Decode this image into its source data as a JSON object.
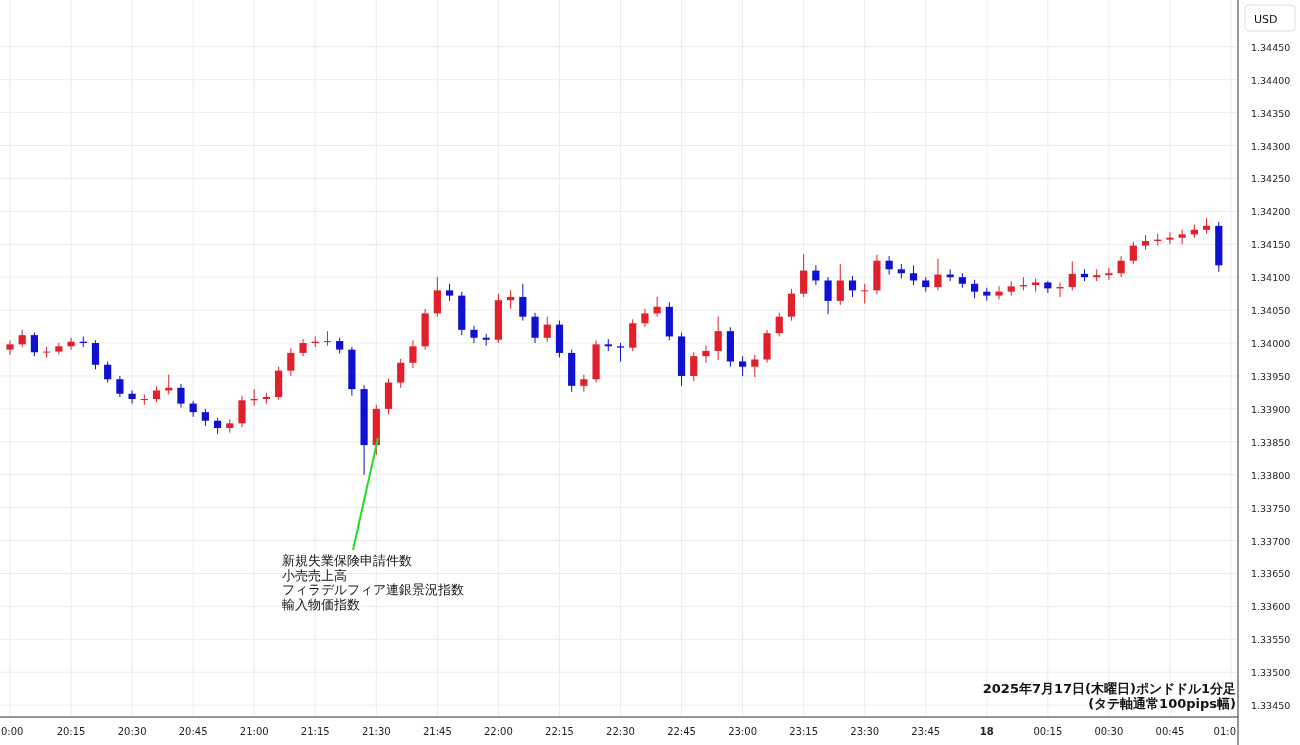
{
  "price_axis": {
    "currency": "USD"
  },
  "chart_data": {
    "type": "candlestick",
    "grid": true,
    "ylim": [
      1.33432,
      1.34521
    ],
    "categories": [
      "0:00",
      null,
      null,
      null,
      null,
      "20:15",
      null,
      null,
      null,
      null,
      "20:30",
      null,
      null,
      null,
      null,
      "20:45",
      null,
      null,
      null,
      null,
      "21:00",
      null,
      null,
      null,
      null,
      "21:15",
      null,
      null,
      null,
      null,
      "21:30",
      null,
      null,
      null,
      null,
      "21:45",
      null,
      null,
      null,
      null,
      "22:00",
      null,
      null,
      null,
      null,
      "22:15",
      null,
      null,
      null,
      null,
      "22:30",
      null,
      null,
      null,
      null,
      "22:45",
      null,
      null,
      null,
      null,
      "23:00",
      null,
      null,
      null,
      null,
      "23:15",
      null,
      null,
      null,
      null,
      "23:30",
      null,
      null,
      null,
      null,
      "23:45",
      null,
      null,
      null,
      null,
      "18",
      null,
      null,
      null,
      null,
      "00:15",
      null,
      null,
      null,
      null,
      "00:30",
      null,
      null,
      null,
      null,
      "00:45",
      null,
      null,
      null,
      null,
      "01:0"
    ],
    "ohlc": [
      [
        1.3399,
        1.34004,
        1.33982,
        1.33998
      ],
      [
        1.33998,
        1.3402,
        1.33994,
        1.34012
      ],
      [
        1.34012,
        1.34016,
        1.3398,
        1.33986
      ],
      [
        1.33986,
        1.33994,
        1.33978,
        1.33987
      ],
      [
        1.33987,
        1.34,
        1.33983,
        1.33995
      ],
      [
        1.33995,
        1.34008,
        1.3399,
        1.34002
      ],
      [
        1.34002,
        1.3401,
        1.33994,
        1.34
      ],
      [
        1.34,
        1.34004,
        1.3396,
        1.33967
      ],
      [
        1.33967,
        1.33972,
        1.3394,
        1.33945
      ],
      [
        1.33945,
        1.3395,
        1.33918,
        1.33923
      ],
      [
        1.33923,
        1.33928,
        1.33908,
        1.33915
      ],
      [
        1.33915,
        1.33922,
        1.33906,
        1.33915
      ],
      [
        1.33915,
        1.33934,
        1.3391,
        1.33928
      ],
      [
        1.33928,
        1.33952,
        1.33922,
        1.33932
      ],
      [
        1.33932,
        1.33938,
        1.33902,
        1.33908
      ],
      [
        1.33908,
        1.33912,
        1.33888,
        1.33895
      ],
      [
        1.33895,
        1.339,
        1.33874,
        1.33882
      ],
      [
        1.33882,
        1.33886,
        1.33862,
        1.33871
      ],
      [
        1.33871,
        1.33884,
        1.33864,
        1.33878
      ],
      [
        1.33878,
        1.3392,
        1.33872,
        1.33913
      ],
      [
        1.33913,
        1.3393,
        1.33905,
        1.33915
      ],
      [
        1.33915,
        1.33924,
        1.33908,
        1.33918
      ],
      [
        1.33918,
        1.33964,
        1.33914,
        1.33958
      ],
      [
        1.33958,
        1.33992,
        1.3395,
        1.33985
      ],
      [
        1.33985,
        1.34006,
        1.3398,
        1.34
      ],
      [
        1.34,
        1.3401,
        1.33994,
        1.34002
      ],
      [
        1.34002,
        1.34018,
        1.33996,
        1.34003
      ],
      [
        1.34003,
        1.34008,
        1.33984,
        1.3399
      ],
      [
        1.3399,
        1.33994,
        1.3392,
        1.3393
      ],
      [
        1.3393,
        1.33936,
        1.338,
        1.33845
      ],
      [
        1.33845,
        1.33906,
        1.3383,
        1.339
      ],
      [
        1.339,
        1.33946,
        1.33892,
        1.3394
      ],
      [
        1.3394,
        1.33976,
        1.33932,
        1.3397
      ],
      [
        1.3397,
        1.34004,
        1.33962,
        1.33995
      ],
      [
        1.33995,
        1.34052,
        1.3399,
        1.34045
      ],
      [
        1.34045,
        1.341,
        1.3404,
        1.3408
      ],
      [
        1.3408,
        1.3409,
        1.34064,
        1.34072
      ],
      [
        1.34072,
        1.34078,
        1.34012,
        1.3402
      ],
      [
        1.3402,
        1.34026,
        1.34,
        1.34008
      ],
      [
        1.34008,
        1.34014,
        1.33996,
        1.34005
      ],
      [
        1.34005,
        1.34075,
        1.34,
        1.34065
      ],
      [
        1.34065,
        1.3408,
        1.34052,
        1.3407
      ],
      [
        1.3407,
        1.3409,
        1.34034,
        1.3404
      ],
      [
        1.3404,
        1.34046,
        1.34,
        1.34008
      ],
      [
        1.34008,
        1.3404,
        1.34002,
        1.34028
      ],
      [
        1.34028,
        1.34034,
        1.33978,
        1.33985
      ],
      [
        1.33985,
        1.3399,
        1.33926,
        1.33935
      ],
      [
        1.33935,
        1.33952,
        1.33926,
        1.33945
      ],
      [
        1.33945,
        1.34004,
        1.3394,
        1.33998
      ],
      [
        1.33998,
        1.34006,
        1.33988,
        1.33995
      ],
      [
        1.33995,
        1.34,
        1.33972,
        1.33993
      ],
      [
        1.33993,
        1.34036,
        1.33988,
        1.3403
      ],
      [
        1.3403,
        1.34052,
        1.34024,
        1.34045
      ],
      [
        1.34045,
        1.3407,
        1.3404,
        1.34055
      ],
      [
        1.34055,
        1.34062,
        1.34004,
        1.3401
      ],
      [
        1.3401,
        1.34016,
        1.33935,
        1.3395
      ],
      [
        1.3395,
        1.33986,
        1.33942,
        1.3398
      ],
      [
        1.3398,
        1.33996,
        1.3397,
        1.33988
      ],
      [
        1.33988,
        1.3404,
        1.33974,
        1.34018
      ],
      [
        1.34018,
        1.34024,
        1.33964,
        1.33972
      ],
      [
        1.33972,
        1.3398,
        1.3395,
        1.33964
      ],
      [
        1.33964,
        1.33982,
        1.33948,
        1.33975
      ],
      [
        1.33975,
        1.3402,
        1.3397,
        1.34015
      ],
      [
        1.34015,
        1.34046,
        1.3401,
        1.3404
      ],
      [
        1.3404,
        1.34082,
        1.34034,
        1.34075
      ],
      [
        1.34075,
        1.34135,
        1.3407,
        1.3411
      ],
      [
        1.3411,
        1.34118,
        1.34088,
        1.34095
      ],
      [
        1.34095,
        1.341,
        1.34044,
        1.34064
      ],
      [
        1.34064,
        1.3412,
        1.34058,
        1.34095
      ],
      [
        1.34095,
        1.34102,
        1.3407,
        1.3408
      ],
      [
        1.3408,
        1.3409,
        1.3406,
        1.3408
      ],
      [
        1.3408,
        1.34134,
        1.34074,
        1.34125
      ],
      [
        1.34125,
        1.34132,
        1.34104,
        1.34112
      ],
      [
        1.34112,
        1.3412,
        1.34098,
        1.34106
      ],
      [
        1.34106,
        1.34118,
        1.34088,
        1.34095
      ],
      [
        1.34095,
        1.341,
        1.34078,
        1.34085
      ],
      [
        1.34085,
        1.34128,
        1.3408,
        1.34104
      ],
      [
        1.34104,
        1.34112,
        1.34094,
        1.341
      ],
      [
        1.341,
        1.34106,
        1.34084,
        1.3409
      ],
      [
        1.3409,
        1.34096,
        1.34068,
        1.34078
      ],
      [
        1.34078,
        1.34084,
        1.34064,
        1.34072
      ],
      [
        1.34072,
        1.34086,
        1.34066,
        1.34078
      ],
      [
        1.34078,
        1.34094,
        1.34072,
        1.34086
      ],
      [
        1.34086,
        1.341,
        1.3408,
        1.34088
      ],
      [
        1.34088,
        1.34098,
        1.34078,
        1.34092
      ],
      [
        1.34092,
        1.34094,
        1.34076,
        1.34083
      ],
      [
        1.34083,
        1.34092,
        1.3407,
        1.34085
      ],
      [
        1.34085,
        1.34124,
        1.3408,
        1.34105
      ],
      [
        1.34105,
        1.34112,
        1.34094,
        1.341
      ],
      [
        1.341,
        1.34112,
        1.34094,
        1.34103
      ],
      [
        1.34103,
        1.34114,
        1.34096,
        1.34106
      ],
      [
        1.34106,
        1.34132,
        1.341,
        1.34125
      ],
      [
        1.34125,
        1.34154,
        1.3412,
        1.34148
      ],
      [
        1.34148,
        1.34164,
        1.34142,
        1.34155
      ],
      [
        1.34155,
        1.34166,
        1.34148,
        1.34157
      ],
      [
        1.34157,
        1.34168,
        1.3415,
        1.3416
      ],
      [
        1.3416,
        1.34172,
        1.3415,
        1.34165
      ],
      [
        1.34165,
        1.3418,
        1.3416,
        1.34172
      ],
      [
        1.34172,
        1.3419,
        1.34166,
        1.34178
      ],
      [
        1.34178,
        1.34184,
        1.34108,
        1.34118
      ],
      null
    ],
    "yticks": [
      {
        "value": 1.3445,
        "label": "1.34450"
      },
      {
        "value": 1.344,
        "label": "1.34400"
      },
      {
        "value": 1.3435,
        "label": "1.34350"
      },
      {
        "value": 1.343,
        "label": "1.34300"
      },
      {
        "value": 1.3425,
        "label": "1.34250"
      },
      {
        "value": 1.342,
        "label": "1.34200"
      },
      {
        "value": 1.3415,
        "label": "1.34150"
      },
      {
        "value": 1.341,
        "label": "1.34100"
      },
      {
        "value": 1.3405,
        "label": "1.34050"
      },
      {
        "value": 1.34,
        "label": "1.34000"
      },
      {
        "value": 1.3395,
        "label": "1.33950"
      },
      {
        "value": 1.339,
        "label": "1.33900"
      },
      {
        "value": 1.3385,
        "label": "1.33850"
      },
      {
        "value": 1.338,
        "label": "1.33800"
      },
      {
        "value": 1.3375,
        "label": "1.33750"
      },
      {
        "value": 1.337,
        "label": "1.33700"
      },
      {
        "value": 1.3365,
        "label": "1.33650"
      },
      {
        "value": 1.336,
        "label": "1.33600"
      },
      {
        "value": 1.3355,
        "label": "1.33550"
      },
      {
        "value": 1.335,
        "label": "1.33500"
      },
      {
        "value": 1.3345,
        "label": "1.33450"
      }
    ]
  },
  "annotation": {
    "lines": [
      "新規失業保険申請件数",
      "小売売上高",
      "フィラデルフィア連銀景況指数",
      "輸入物価指数"
    ]
  },
  "caption": {
    "lines": [
      "2025年7月17日(木曜日)ポンドドル1分足",
      "(タテ軸通常100pips幅)"
    ]
  }
}
